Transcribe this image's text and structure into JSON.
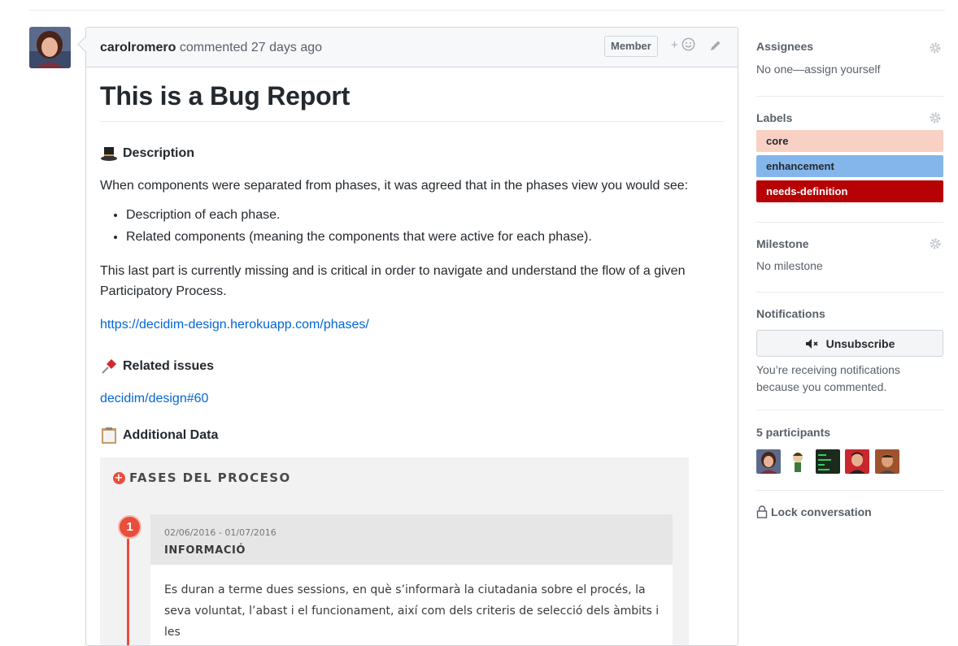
{
  "comment": {
    "author": "carolromero",
    "action": "commented 27 days ago",
    "badge": "Member",
    "reaction_label": "+",
    "title": "This is a Bug Report",
    "description_heading": "Description",
    "intro": "When components were separated from phases, it was agreed that in the phases view you would see:",
    "bullets": [
      "Description of each phase.",
      "Related components (meaning the components that were active for each phase)."
    ],
    "missing_note": "This last part is currently missing and is critical in order to navigate and understand the flow of a given Participatory Process.",
    "link": "https://decidim-design.herokuapp.com/phases/",
    "related_heading": "Related issues",
    "related_link": "decidim/design#60",
    "additional_heading": "Additional Data"
  },
  "embed": {
    "title": "FASES DEL PROCESO",
    "step_number": "1",
    "date_range": "02/06/2016 - 01/07/2016",
    "phase_name": "INFORMACIÓ",
    "phase_desc": "Es duran a terme dues sessions, en què s’informarà la ciutadania sobre el procés, la seva voluntat, l’abast i el funcionament, així com dels criteris de selecció dels àmbits i les"
  },
  "sidebar": {
    "assignees_title": "Assignees",
    "assignees_value": "No one—assign yourself",
    "labels_title": "Labels",
    "labels": [
      {
        "name": "core",
        "bg": "#f9d0c4",
        "fg": "#24292e"
      },
      {
        "name": "enhancement",
        "bg": "#84b6eb",
        "fg": "#24292e"
      },
      {
        "name": "needs-definition",
        "bg": "#b60205",
        "fg": "#ffffff"
      }
    ],
    "milestone_title": "Milestone",
    "milestone_value": "No milestone",
    "notifications_title": "Notifications",
    "unsubscribe_label": "Unsubscribe",
    "notifications_reason": "You’re receiving notifications because you commented.",
    "participants_title": "5 participants",
    "lock_label": "Lock conversation"
  },
  "colors": {
    "link": "#0366d6",
    "accent_red": "#e94e3c"
  }
}
